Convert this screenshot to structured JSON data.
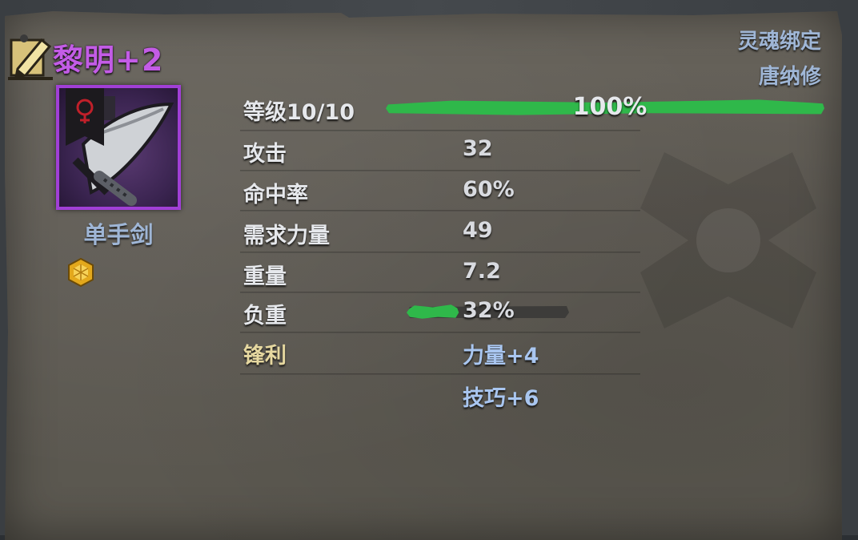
{
  "item": {
    "name": "黎明+2",
    "type": "单手剑",
    "rarity_color": "#c35ce6"
  },
  "header": {
    "soulbound": "灵魂绑定",
    "owner": "唐纳修"
  },
  "level": {
    "label": "等级10/10",
    "percent_text": "100%",
    "progress": 1.0,
    "bar_color": "#2fb84a"
  },
  "stats": [
    {
      "label": "攻击",
      "value": "32"
    },
    {
      "label": "命中率",
      "value": "60%"
    },
    {
      "label": "需求力量",
      "value": "49"
    },
    {
      "label": "重量",
      "value": "7.2"
    }
  ],
  "burden": {
    "label": "负重",
    "percent_text": "32%",
    "progress": 0.32
  },
  "enchant": {
    "name": "锋利",
    "bonuses": [
      "力量+4",
      "技巧+6"
    ]
  },
  "icons": {
    "edit": "edit-pencil-icon",
    "sword": "sword-item-icon",
    "gem": "gem-socket-icon"
  }
}
